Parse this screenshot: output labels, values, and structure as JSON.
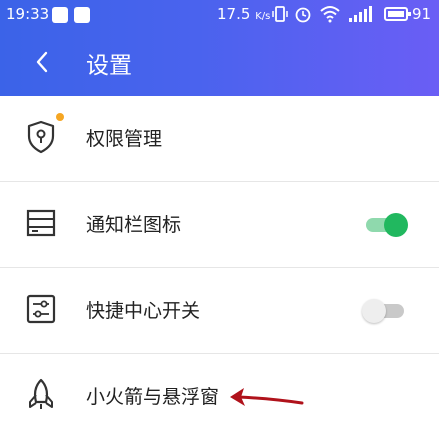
{
  "status_bar": {
    "time": "19:33",
    "network_speed": "17.5",
    "network_speed_unit": "K/s",
    "battery_level": "91"
  },
  "header": {
    "title": "设置",
    "back_icon": "chevron-left-icon",
    "gradient_colors": [
      "#3b63e8",
      "#6a5ef5"
    ]
  },
  "settings": {
    "items": [
      {
        "label": "权限管理",
        "icon": "shield-lock-icon",
        "badge": true
      },
      {
        "label": "通知栏图标",
        "icon": "notification-bar-icon",
        "toggle": "on"
      },
      {
        "label": "快捷中心开关",
        "icon": "sliders-icon",
        "toggle": "off"
      },
      {
        "label": "小火箭与悬浮窗",
        "icon": "rocket-icon"
      }
    ]
  },
  "colors": {
    "toggle_on": "#21b85f",
    "toggle_off": "#c9c9c9",
    "badge": "#f5a623",
    "annotation_arrow": "#b0121b"
  }
}
